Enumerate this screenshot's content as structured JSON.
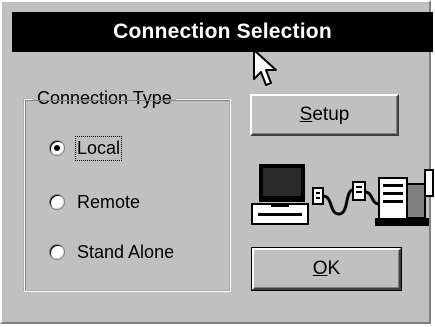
{
  "window": {
    "title": "Connection Selection"
  },
  "group": {
    "legend": "Connection Type",
    "options": [
      {
        "label": "Local",
        "checked": true
      },
      {
        "label": "Remote",
        "checked": false
      },
      {
        "label": "Stand Alone",
        "checked": false
      }
    ]
  },
  "buttons": {
    "setup": {
      "mnemonic": "S",
      "rest": "etup"
    },
    "ok": {
      "mnemonic": "O",
      "rest": "K"
    }
  },
  "icons": {
    "cursor": "arrow-cursor-icon",
    "illustration": "computer-cable-printer-icon"
  }
}
